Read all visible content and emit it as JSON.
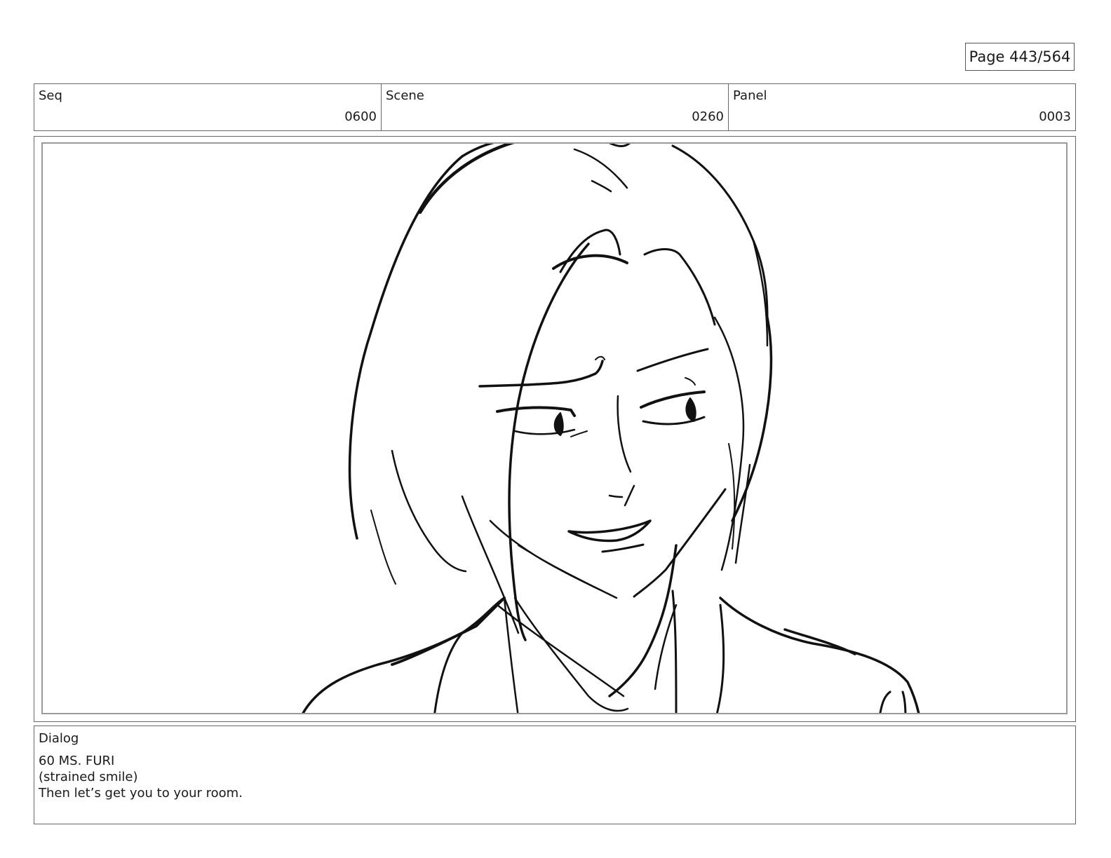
{
  "page": {
    "page_number": "Page 443/564"
  },
  "header": {
    "seq": {
      "label": "Seq",
      "value": "0600"
    },
    "scene": {
      "label": "Scene",
      "value": "0260"
    },
    "panel": {
      "label": "Panel",
      "value": "0003"
    }
  },
  "dialog": {
    "label": "Dialog",
    "lines": [
      "60 MS. FURI",
      "(strained smile)",
      "Then let’s get you to your room."
    ]
  }
}
